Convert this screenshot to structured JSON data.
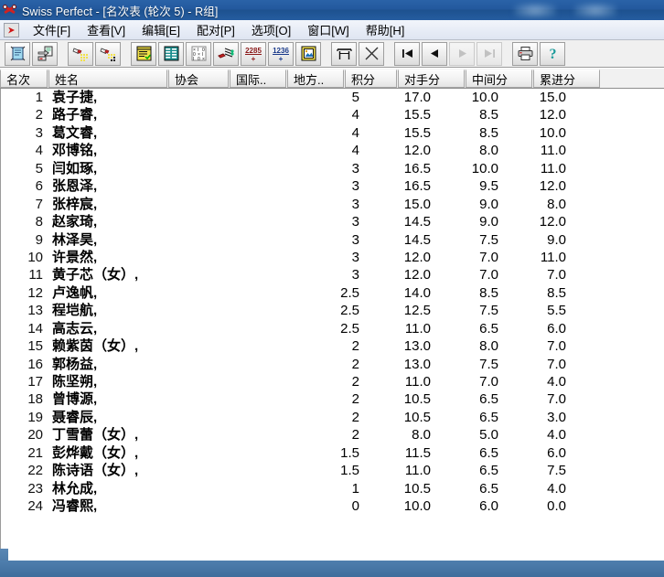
{
  "window": {
    "title": "Swiss Perfect - [名次表 (轮次 5) - R组]",
    "app_icon": "crossed-keys-icon"
  },
  "menu": {
    "items": [
      {
        "label": "文件[F]",
        "name": "file"
      },
      {
        "label": "查看[V]",
        "name": "view"
      },
      {
        "label": "编辑[E]",
        "name": "edit"
      },
      {
        "label": "配对[P]",
        "name": "pairing"
      },
      {
        "label": "选项[O]",
        "name": "options"
      },
      {
        "label": "窗口[W]",
        "name": "window"
      },
      {
        "label": "帮助[H]",
        "name": "help"
      }
    ]
  },
  "toolbar": {
    "buttons": [
      {
        "name": "new-tournament-icon",
        "title": "新建"
      },
      {
        "name": "open-export-icon",
        "title": "打开"
      },
      {
        "name": "torch-left-icon",
        "title": "搜索"
      },
      {
        "name": "torch-right-icon",
        "title": "搜索下一个"
      },
      {
        "name": "player-list-icon",
        "title": "选手列表"
      },
      {
        "name": "crosstable-icon",
        "title": "交叉表"
      },
      {
        "name": "results-grid-icon",
        "title": "成绩录入"
      },
      {
        "name": "pairing-icon",
        "title": "自动配对"
      },
      {
        "name": "rating-2285-icon",
        "title": "等级分计算"
      },
      {
        "name": "rating-1236-icon",
        "title": "等级分表"
      },
      {
        "name": "card-icon",
        "title": "选手卡"
      },
      {
        "name": "table-icon",
        "title": "表格"
      },
      {
        "name": "scissors-icon",
        "title": "剪切"
      },
      {
        "name": "first-round-icon",
        "title": "首轮"
      },
      {
        "name": "prev-round-icon",
        "title": "上一轮"
      },
      {
        "name": "next-round-icon",
        "title": "下一轮"
      },
      {
        "name": "last-round-icon",
        "title": "末轮"
      },
      {
        "name": "print-icon",
        "title": "打印"
      },
      {
        "name": "help-icon",
        "title": "帮助"
      }
    ]
  },
  "table": {
    "columns": [
      {
        "label": "名次",
        "name": "rank"
      },
      {
        "label": "姓名",
        "name": "name"
      },
      {
        "label": "协会",
        "name": "federation"
      },
      {
        "label": "国际..",
        "name": "international-rating"
      },
      {
        "label": "地方..",
        "name": "local-rating"
      },
      {
        "label": "积分",
        "name": "points"
      },
      {
        "label": "对手分",
        "name": "buchholz"
      },
      {
        "label": "中间分",
        "name": "median"
      },
      {
        "label": "累进分",
        "name": "progressive"
      }
    ],
    "rows": [
      {
        "rank": "1",
        "name": "袁子捷,",
        "federation": "",
        "intl": "",
        "local": "",
        "points": "5",
        "buchholz": "17.0",
        "median": "10.0",
        "progressive": "15.0"
      },
      {
        "rank": "2",
        "name": "路子睿,",
        "federation": "",
        "intl": "",
        "local": "",
        "points": "4",
        "buchholz": "15.5",
        "median": "8.5",
        "progressive": "12.0"
      },
      {
        "rank": "3",
        "name": "葛文睿,",
        "federation": "",
        "intl": "",
        "local": "",
        "points": "4",
        "buchholz": "15.5",
        "median": "8.5",
        "progressive": "10.0"
      },
      {
        "rank": "4",
        "name": "邓博铭,",
        "federation": "",
        "intl": "",
        "local": "",
        "points": "4",
        "buchholz": "12.0",
        "median": "8.0",
        "progressive": "11.0"
      },
      {
        "rank": "5",
        "name": "闫如琢,",
        "federation": "",
        "intl": "",
        "local": "",
        "points": "3",
        "buchholz": "16.5",
        "median": "10.0",
        "progressive": "11.0"
      },
      {
        "rank": "6",
        "name": "张恩泽,",
        "federation": "",
        "intl": "",
        "local": "",
        "points": "3",
        "buchholz": "16.5",
        "median": "9.5",
        "progressive": "12.0"
      },
      {
        "rank": "7",
        "name": "张梓宸,",
        "federation": "",
        "intl": "",
        "local": "",
        "points": "3",
        "buchholz": "15.0",
        "median": "9.0",
        "progressive": "8.0"
      },
      {
        "rank": "8",
        "name": "赵家琦,",
        "federation": "",
        "intl": "",
        "local": "",
        "points": "3",
        "buchholz": "14.5",
        "median": "9.0",
        "progressive": "12.0"
      },
      {
        "rank": "9",
        "name": "林泽昊,",
        "federation": "",
        "intl": "",
        "local": "",
        "points": "3",
        "buchholz": "14.5",
        "median": "7.5",
        "progressive": "9.0"
      },
      {
        "rank": "10",
        "name": "许景然,",
        "federation": "",
        "intl": "",
        "local": "",
        "points": "3",
        "buchholz": "12.0",
        "median": "7.0",
        "progressive": "11.0"
      },
      {
        "rank": "11",
        "name": "黄子芯（女）,",
        "federation": "",
        "intl": "",
        "local": "",
        "points": "3",
        "buchholz": "12.0",
        "median": "7.0",
        "progressive": "7.0"
      },
      {
        "rank": "12",
        "name": "卢逸帆,",
        "federation": "",
        "intl": "",
        "local": "",
        "points": "2.5",
        "buchholz": "14.0",
        "median": "8.5",
        "progressive": "8.5"
      },
      {
        "rank": "13",
        "name": "程垲航,",
        "federation": "",
        "intl": "",
        "local": "",
        "points": "2.5",
        "buchholz": "12.5",
        "median": "7.5",
        "progressive": "5.5"
      },
      {
        "rank": "14",
        "name": "高志云,",
        "federation": "",
        "intl": "",
        "local": "",
        "points": "2.5",
        "buchholz": "11.0",
        "median": "6.5",
        "progressive": "6.0"
      },
      {
        "rank": "15",
        "name": "赖紫茵（女）,",
        "federation": "",
        "intl": "",
        "local": "",
        "points": "2",
        "buchholz": "13.0",
        "median": "8.0",
        "progressive": "7.0"
      },
      {
        "rank": "16",
        "name": "郭杨益,",
        "federation": "",
        "intl": "",
        "local": "",
        "points": "2",
        "buchholz": "13.0",
        "median": "7.5",
        "progressive": "7.0"
      },
      {
        "rank": "17",
        "name": "陈坚朔,",
        "federation": "",
        "intl": "",
        "local": "",
        "points": "2",
        "buchholz": "11.0",
        "median": "7.0",
        "progressive": "4.0"
      },
      {
        "rank": "18",
        "name": "曾博源,",
        "federation": "",
        "intl": "",
        "local": "",
        "points": "2",
        "buchholz": "10.5",
        "median": "6.5",
        "progressive": "7.0"
      },
      {
        "rank": "19",
        "name": "聂睿辰,",
        "federation": "",
        "intl": "",
        "local": "",
        "points": "2",
        "buchholz": "10.5",
        "median": "6.5",
        "progressive": "3.0"
      },
      {
        "rank": "20",
        "name": "丁雪蕾（女）,",
        "federation": "",
        "intl": "",
        "local": "",
        "points": "2",
        "buchholz": "8.0",
        "median": "5.0",
        "progressive": "4.0"
      },
      {
        "rank": "21",
        "name": "彭烨戴（女）,",
        "federation": "",
        "intl": "",
        "local": "",
        "points": "1.5",
        "buchholz": "11.5",
        "median": "6.5",
        "progressive": "6.0"
      },
      {
        "rank": "22",
        "name": "陈诗语（女）,",
        "federation": "",
        "intl": "",
        "local": "",
        "points": "1.5",
        "buchholz": "11.0",
        "median": "6.5",
        "progressive": "7.5"
      },
      {
        "rank": "23",
        "name": "林允成,",
        "federation": "",
        "intl": "",
        "local": "",
        "points": "1",
        "buchholz": "10.5",
        "median": "6.5",
        "progressive": "4.0"
      },
      {
        "rank": "24",
        "name": "冯睿熙,",
        "federation": "",
        "intl": "",
        "local": "",
        "points": "0",
        "buchholz": "10.0",
        "median": "6.0",
        "progressive": "0.0"
      }
    ]
  },
  "colors": {
    "titlebar": "#23599e",
    "desktop": "#43709f",
    "toolbar_bg": "#f0f0f0",
    "header_bg": "#f1f1f1",
    "grid_bg": "#ffffff"
  }
}
